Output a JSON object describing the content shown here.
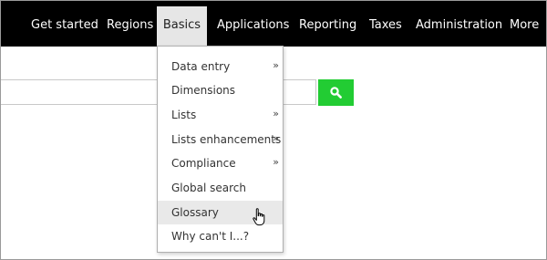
{
  "nav": {
    "items": [
      {
        "label": "Get started"
      },
      {
        "label": "Regions"
      },
      {
        "label": "Basics"
      },
      {
        "label": "Applications"
      },
      {
        "label": "Reporting"
      },
      {
        "label": "Taxes"
      },
      {
        "label": "Administration"
      },
      {
        "label": "More"
      }
    ],
    "active_item": "Basics"
  },
  "search": {
    "value": "",
    "placeholder": "",
    "button_icon": "magnifier-icon"
  },
  "basics_menu": {
    "submenu_indicator": "»",
    "hovered_item": "Glossary",
    "items": [
      {
        "label": "Data entry",
        "has_submenu": true
      },
      {
        "label": "Dimensions",
        "has_submenu": false
      },
      {
        "label": "Lists",
        "has_submenu": true
      },
      {
        "label": "Lists enhancements",
        "has_submenu": true
      },
      {
        "label": "Compliance",
        "has_submenu": true
      },
      {
        "label": "Global search",
        "has_submenu": false
      },
      {
        "label": "Glossary",
        "has_submenu": false
      },
      {
        "label": "Why can't I...?",
        "has_submenu": false
      }
    ]
  },
  "colors": {
    "navbar_background": "#000000",
    "nav_active_background": "#e6e6e6",
    "search_button": "#22cc33",
    "menu_hover": "#e9e9e9"
  },
  "pointer": {
    "icon": "hand-pointer-icon"
  }
}
